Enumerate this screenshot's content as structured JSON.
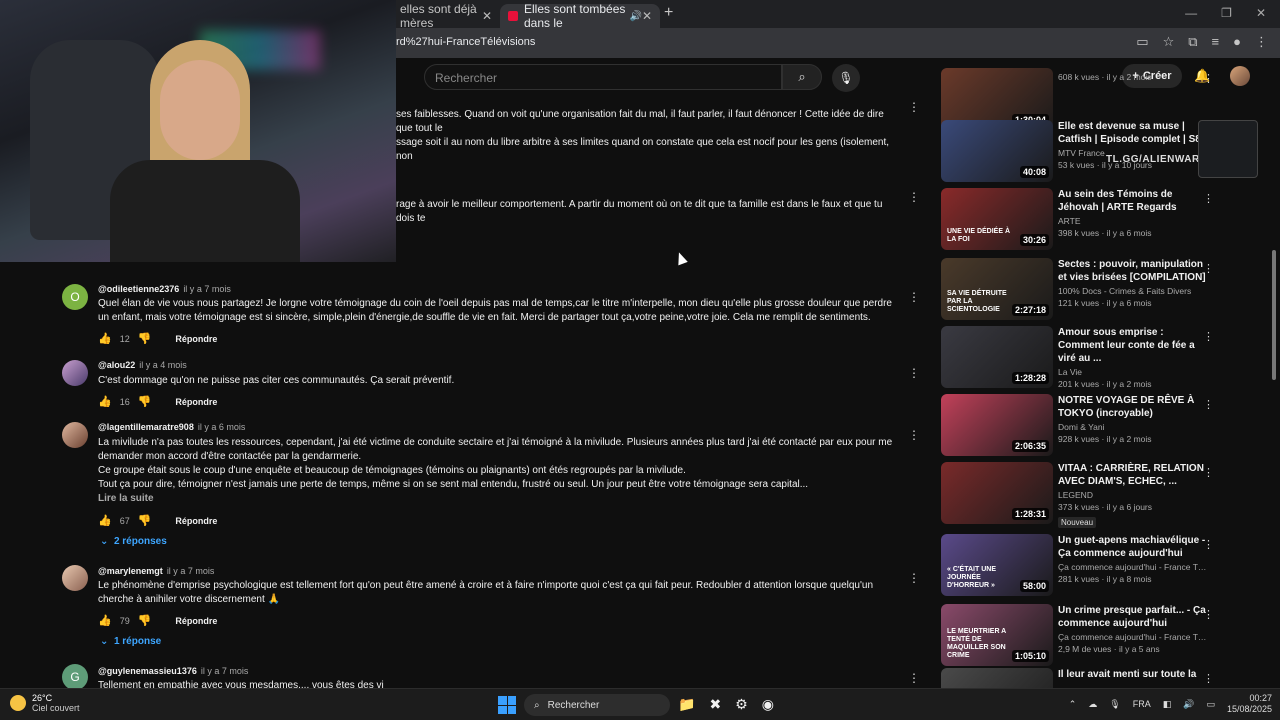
{
  "browser": {
    "tabs": [
      {
        "label": "elles sont déjà mères"
      },
      {
        "label": "Elles sont tombées dans le"
      }
    ],
    "url": "rd%27hui-FranceTélévisions"
  },
  "youtube": {
    "search_placeholder": "Rechercher",
    "create_label": "Créer"
  },
  "comments": [
    {
      "partial_top": "ses faiblesses. Quand on voit qu'une organisation fait du mal, il faut parler, il faut dénoncer ! Cette idée de dire que tout le",
      "partial_top2": "ssage soit il au nom du libre arbitre à ses limites quand on constate que cela est nocif pour les gens (isolement, non"
    },
    {
      "partial": "rage à avoir le meilleur comportement. A partir du moment où on te dit que ta famille est dans le faux et que tu dois te"
    },
    {
      "author": "@odileetienne2376",
      "when": "il y a 7 mois",
      "avatar_letter": "O",
      "text": "Quel élan de vie vous nous partagez! Je  lorgne votre témoignage du coin de l'oeil depuis pas mal de temps,car le titre m'interpelle, mon dieu qu'elle plus grosse douleur que perdre un enfant, mais votre témoignage est si sincère, simple,plein d'énergie,de souffle de vie en fait. Merci de partager tout ça,votre peine,votre joie. Cela me remplit de sentiments.",
      "likes": "12",
      "reply": "Répondre"
    },
    {
      "author": "@alou22",
      "when": "il y a 4 mois",
      "text": "C'est dommage qu'on ne puisse pas citer ces communautés. Ça serait préventif.",
      "likes": "16",
      "reply": "Répondre"
    },
    {
      "author": "@lagentillemaratre908",
      "when": "il y a 6 mois",
      "text_lines": [
        "La mivilude n'a pas toutes les ressources, cependant, j'ai été victime de conduite sectaire et j'ai témoigné à la mivilude. Plusieurs années plus tard j'ai été contacté par eux pour me demander mon accord d'être contactée par la gendarmerie.",
        "Ce groupe était sous le coup d'une enquête et beaucoup de témoignages (témoins ou plaignants) ont étés regroupés par la mivilude.",
        "Tout ça pour dire, témoigner n'est jamais une perte de temps, même si on se sent mal entendu, frustré ou seul. Un jour peut être votre témoignage sera capital..."
      ],
      "read_more": "Lire la suite",
      "likes": "67",
      "reply": "Répondre",
      "replies": "2 réponses"
    },
    {
      "author": "@marylenemgt",
      "when": "il y a 7 mois",
      "text": "Le phénomène d'emprise psychologique est tellement fort qu'on peut être amené à croire et à faire n'importe quoi c'est ça qui fait peur.  Redoubler d attention lorsque quelqu'un cherche à anihiler votre discernement 🙏",
      "likes": "79",
      "reply": "Répondre",
      "replies": "1 réponse"
    },
    {
      "author": "@guylenemassieu1376",
      "when": "il y a 7 mois",
      "avatar_letter": "G",
      "text": "Tellement en empathie avec vous mesdames.... vous êtes des vi"
    }
  ],
  "sidebar": [
    {
      "duration": "1:30:04",
      "title": "",
      "channel": "",
      "meta": "608 k vues · il y a 2 mois",
      "color": "#6b3a2a"
    },
    {
      "duration": "40:08",
      "title": "Elle est devenue sa muse | Catfish | Episode complet | S8",
      "channel": "MTV France",
      "meta": "53 k vues · il y a 10 jours",
      "color": "#3a4a7a"
    },
    {
      "duration": "30:26",
      "title": "Au sein des Témoins de Jéhovah | ARTE Regards",
      "channel": "ARTE",
      "meta": "398 k vues · il y a 6 mois",
      "color": "#8a2a2a",
      "thumb_text": "UNE VIE DÉDIÉE À LA FOI"
    },
    {
      "duration": "2:27:18",
      "title": "Sectes : pouvoir, manipulation et vies brisées [COMPILATION]",
      "channel": "100% Docs - Crimes & Faits Divers",
      "meta": "121 k vues · il y a 6 mois",
      "color": "#4a3a2a",
      "thumb_text": "SA VIE DÉTRUITE PAR LA SCIENTOLOGIE"
    },
    {
      "duration": "1:28:28",
      "title": "Amour sous emprise : Comment leur conte de fée a viré au ...",
      "channel": "La Vie",
      "meta": "201 k vues · il y a 2 mois",
      "color": "#3a3a42"
    },
    {
      "duration": "2:06:35",
      "title": "NOTRE VOYAGE DE RÊVE À TOKYO (incroyable)",
      "channel": "Domi & Yani",
      "meta": "928 k vues · il y a 2 mois",
      "color": "#c2415a"
    },
    {
      "duration": "1:28:31",
      "title": "VITAA : CARRIÈRE, RELATION AVEC DIAM'S, ECHEC, ...",
      "channel": "LEGEND",
      "meta": "373 k vues · il y a 6 jours",
      "badge": "Nouveau",
      "color": "#7a2a2a"
    },
    {
      "duration": "58:00",
      "title": "Un guet-apens machiavélique - Ça commence aujourd'hui",
      "channel": "Ça commence aujourd'hui - France Télévi...",
      "meta": "281 k vues · il y a 8 mois",
      "color": "#5a4a8a",
      "thumb_text": "« C'ÉTAIT UNE JOURNÉE D'HORREUR »"
    },
    {
      "duration": "1:05:10",
      "title": "Un crime presque parfait... - Ça commence aujourd'hui",
      "channel": "Ça commence aujourd'hui - France Télévi...",
      "meta": "2,9 M de vues · il y a 5 ans",
      "color": "#8a4a6a",
      "thumb_text": "LE MEURTRIER A TENTÉ DE MAQUILLER SON CRIME"
    },
    {
      "duration": "",
      "title": "Il leur avait menti sur toute la",
      "channel": "",
      "meta": "",
      "color": "#4a4a4a"
    }
  ],
  "overlay": {
    "alienware": "TL.GG/ALIENWARE"
  },
  "taskbar": {
    "temp": "26°C",
    "weather": "Ciel couvert",
    "search": "Rechercher",
    "lang": "FRA",
    "time": "00:27",
    "date": "15/08/2025"
  }
}
